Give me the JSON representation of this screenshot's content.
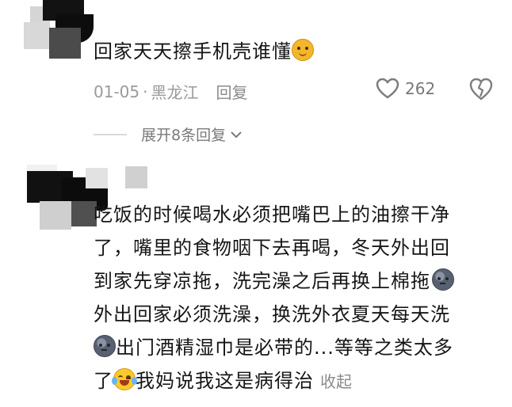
{
  "comments": [
    {
      "text": "回家天天擦手机壳谁懂",
      "emoji": "shy-face",
      "meta": {
        "date": "01-05",
        "separator": "·",
        "location": "黑龙江",
        "reply_label": "回复"
      },
      "likes": "262",
      "expand_label": "展开8条回复"
    },
    {
      "lines": [
        "吃饭的时候喝水必须把嘴巴上的油擦干净",
        "了，嘴里的食物咽下去再喝，冬天外出回",
        "到家先穿凉拖，洗完澡之后再换上棉拖",
        "外出回家必须洗澡，换洗外衣夏天每天洗",
        "出门酒精湿巾是必带的...等等之类太多",
        "了",
        "我妈说我这是病得治"
      ],
      "collapse_label": "收起"
    }
  ],
  "colors": {
    "text": "#161616",
    "meta": "#9a9a9a",
    "mosaic_dark": "#111111",
    "mosaic_gray": "#bfbfbf"
  }
}
